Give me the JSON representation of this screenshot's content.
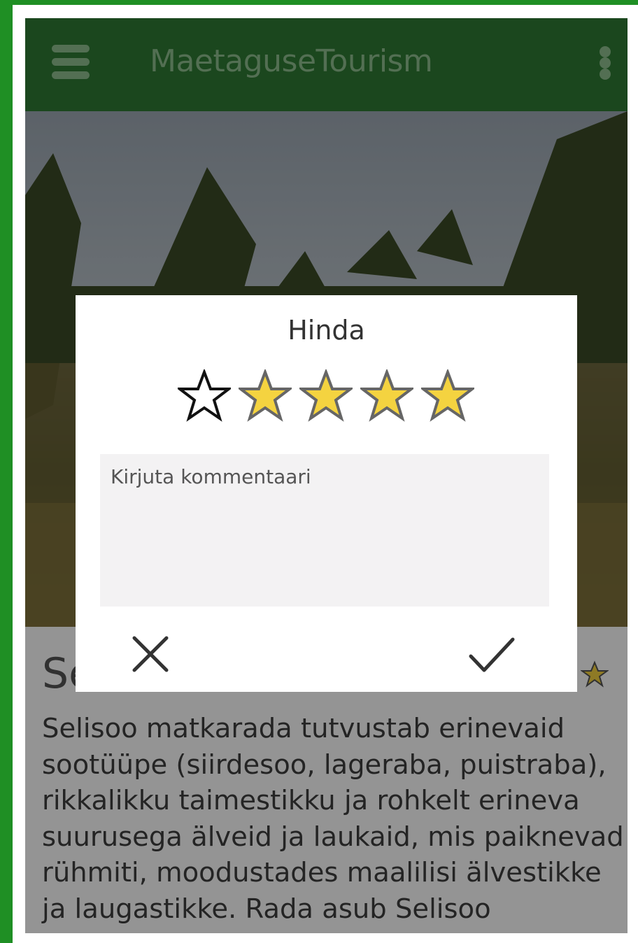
{
  "app": {
    "title": "MaetaguseTourism",
    "menu_icon": "hamburger-menu-icon",
    "overflow_icon": "more-vertical-icon",
    "bar_color": "#2f7a34"
  },
  "content": {
    "title_visible": "Se",
    "description": "Selisoo matkarada tutvustab erinevaid sootüüpe (siirdesoo, lageraba, puistraba), rikkalikku taimestikku ja rohkelt erineva suurusega älveid ja laukaid, mis paiknevad rühmiti, moodustades maalilisi älvestikke ja laugastikke. Rada asub Selisoo looduskaitsealal"
  },
  "dialog": {
    "title": "Hinda",
    "rating": {
      "value": 4,
      "max": 5
    },
    "comment_placeholder": "Kirjuta kommentaari",
    "comment_value": "",
    "cancel_icon": "close-icon",
    "confirm_icon": "checkmark-icon",
    "star_filled_color": "#f4d340",
    "star_empty_color": "#ffffff"
  }
}
